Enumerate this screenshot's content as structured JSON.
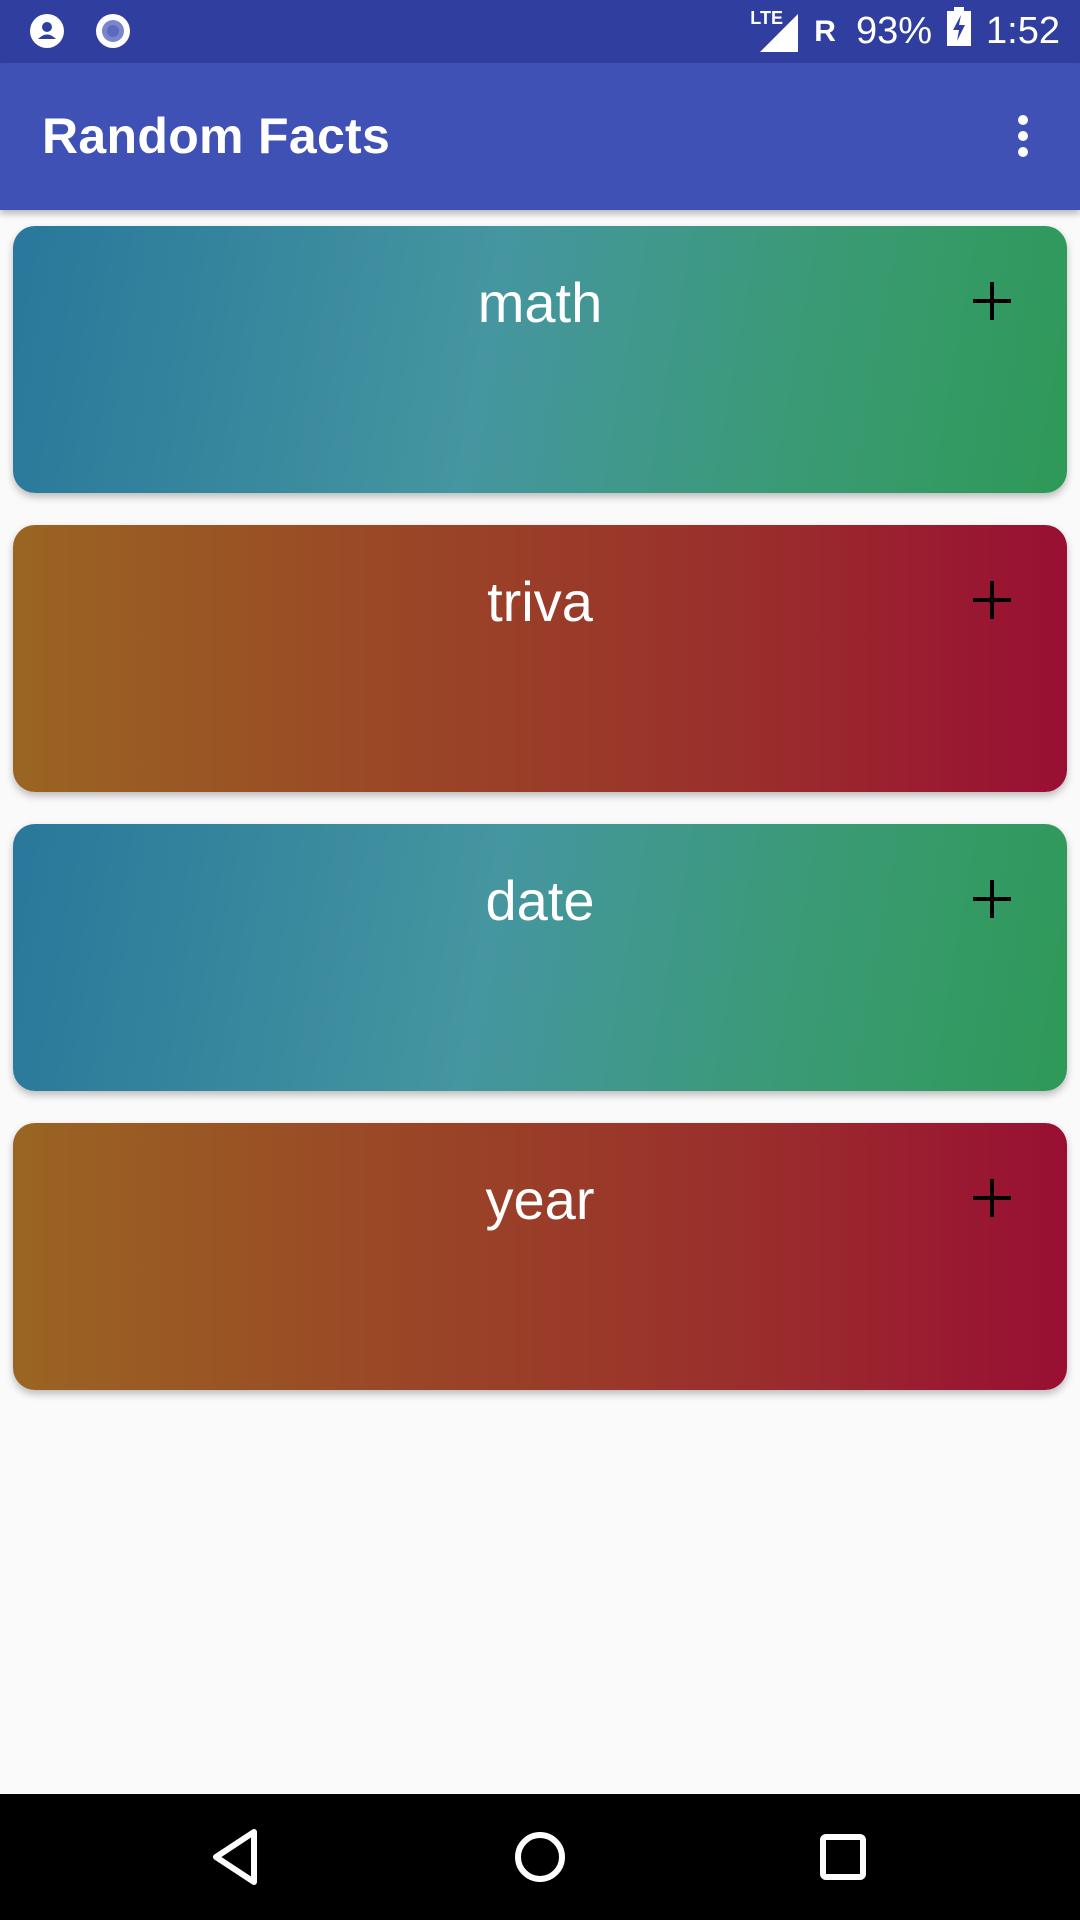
{
  "status_bar": {
    "network": "LTE",
    "roaming": "R",
    "battery": "93%",
    "time": "1:52",
    "icons": [
      "account-circle-icon",
      "sync-circle-icon",
      "signal-icon",
      "battery-charging-icon"
    ]
  },
  "app_bar": {
    "title": "Random Facts",
    "menu_icon": "more-vert-icon"
  },
  "categories": [
    {
      "label": "math",
      "style": "blue-green",
      "action_icon": "plus-icon"
    },
    {
      "label": "triva",
      "style": "orange-red",
      "action_icon": "plus-icon"
    },
    {
      "label": "date",
      "style": "blue-green",
      "action_icon": "plus-icon"
    },
    {
      "label": "year",
      "style": "orange-red",
      "action_icon": "plus-icon"
    }
  ],
  "nav_bar": {
    "icons": [
      "back-icon",
      "home-icon",
      "recents-icon"
    ]
  },
  "colors": {
    "status_bar": "#303f9f",
    "app_bar": "#3f51b5",
    "background": "#fafafa",
    "blue_green_start": "#29779b",
    "blue_green_end": "#2e9957",
    "orange_red_start": "#9a6522",
    "orange_red_end": "#990f33"
  }
}
